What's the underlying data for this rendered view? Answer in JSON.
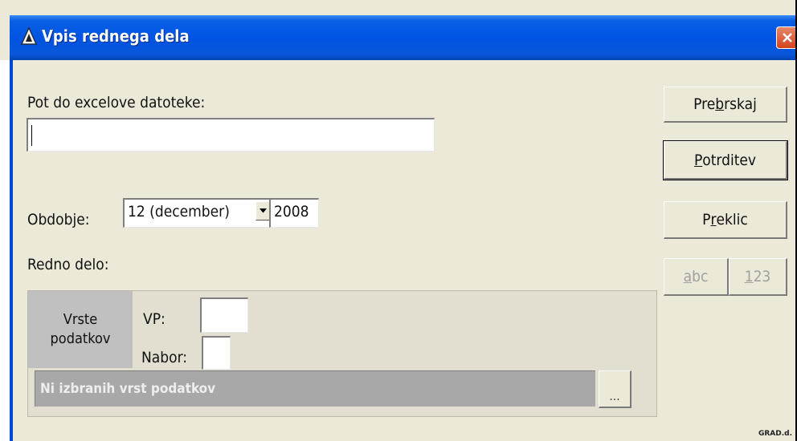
{
  "window": {
    "title": "Vpis rednega dela",
    "corner_label": "GRAD.d."
  },
  "form": {
    "path_label": "Pot do excelove datoteke:",
    "path_value": "",
    "period_label": "Obdobje:",
    "period_month": "12 (december)",
    "period_year": "2008",
    "redno_label": "Redno delo:",
    "types_label": "Vrste podatkov",
    "vp_label": "VP:",
    "vp_value": "",
    "nabor_label": "Nabor:",
    "nabor_value": "",
    "status_text": "Ni izbranih vrst podatkov",
    "dots_label": "..."
  },
  "buttons": {
    "browse": {
      "pre": "Pre",
      "key": "b",
      "post": "rskaj"
    },
    "confirm": {
      "pre": "",
      "key": "P",
      "post": "otrditev"
    },
    "cancel": {
      "pre": "P",
      "key": "r",
      "post": "eklic"
    },
    "abc": {
      "pre": "",
      "key": "a",
      "post": "bc"
    },
    "num": {
      "pre": "",
      "key": "1",
      "post": "23"
    }
  },
  "colors": {
    "title_bar": "#0054e3",
    "window_bg": "#ece9d8",
    "close_button": "#d5431e"
  }
}
